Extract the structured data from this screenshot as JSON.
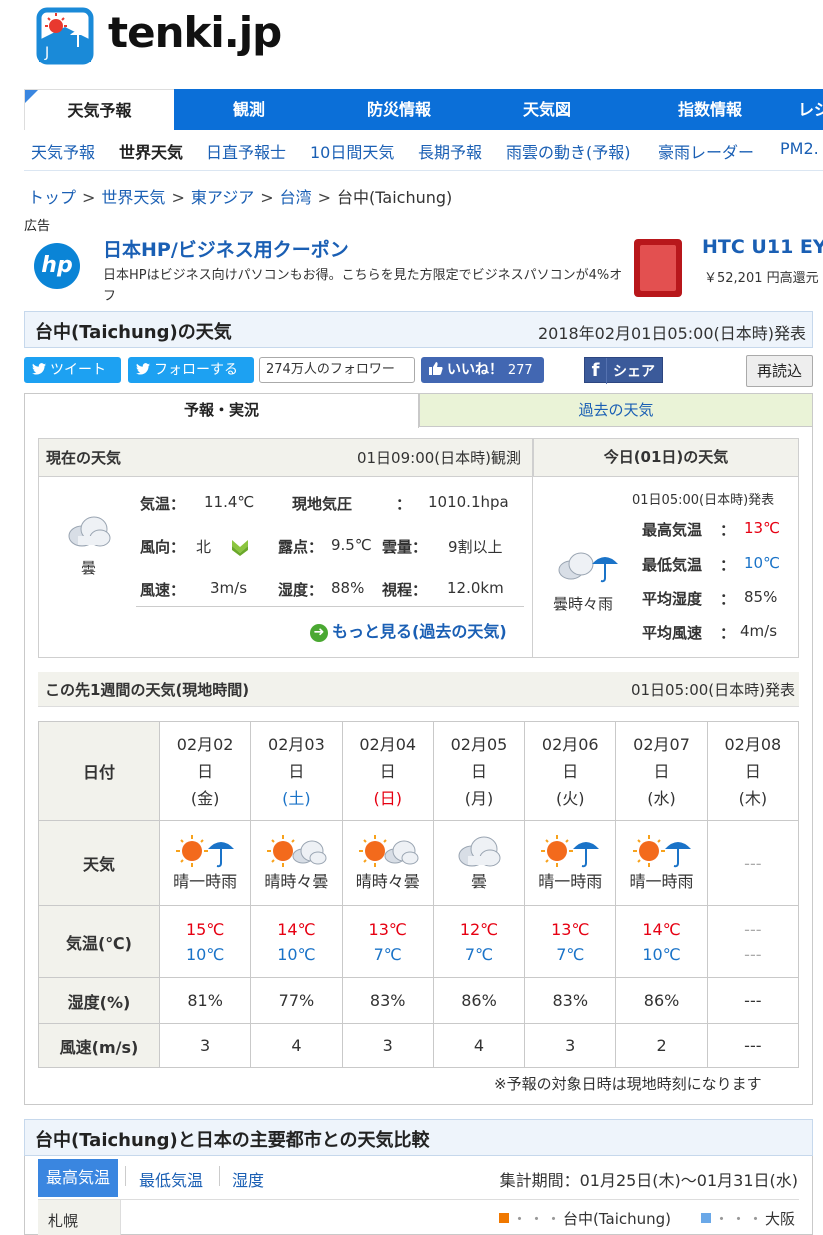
{
  "site": {
    "name": "tenki.jp"
  },
  "mainnav": [
    {
      "label": "天気予報",
      "active": true
    },
    {
      "label": "観測"
    },
    {
      "label": "防災情報"
    },
    {
      "label": "天気図"
    },
    {
      "label": "指数情報"
    },
    {
      "label": "レジ"
    }
  ],
  "subnav": [
    {
      "label": "天気予報"
    },
    {
      "label": "世界天気",
      "active": true
    },
    {
      "label": "日直予報士"
    },
    {
      "label": "10日間天気"
    },
    {
      "label": "長期予報"
    },
    {
      "label": "雨雲の動き(予報)"
    },
    {
      "label": "豪雨レーダー"
    },
    {
      "label": "PM2."
    }
  ],
  "breadcrumb": [
    "トップ",
    "世界天気",
    "東アジア",
    "台湾",
    "台中(Taichung)"
  ],
  "breadcrumb_sep": ">",
  "ads": {
    "label": "広告",
    "ad1": {
      "logo": "hp",
      "title": "日本HP/ビジネス用クーポン",
      "desc": "日本HPはビジネス向けパソコンもお得。こちらを見た方限定でビジネスパソコンが4%オフ"
    },
    "ad2": {
      "title": "HTC U11 EY",
      "desc": "￥52,201 円高還元"
    }
  },
  "page": {
    "title": "台中(Taichung)の天気",
    "issued": "2018年02月01日05:00(日本時)発表"
  },
  "social": {
    "tweet": "ツイート",
    "follow": "フォローする",
    "followers": "274万人のフォロワー",
    "like": "いいね！",
    "like_count": "277",
    "share_f": "f",
    "share": "シェア",
    "reload": "再読込"
  },
  "tabs": {
    "forecast": "予報・実況",
    "past": "過去の天気"
  },
  "current": {
    "heading": "現在の天気",
    "observed": "01日09:00(日本時)観測",
    "icon": "cloud-icon",
    "weather": "曇",
    "temp_label": "気温：",
    "temp": "11.4℃",
    "pressure_label": "現地気圧",
    "pressure_colon": "：",
    "pressure": "1010.1hpa",
    "wind_dir_label": "風向：",
    "wind_dir": "北",
    "dew_label": "露点：",
    "dew": "9.5℃",
    "cloud_label": "雲量：",
    "cloud": "9割以上",
    "wind_speed_label": "風速：",
    "wind_speed": "3m/s",
    "humidity_label": "湿度：",
    "humidity": "88%",
    "visibility_label": "視程：",
    "visibility": "12.0km",
    "more": "もっと見る(過去の天気)"
  },
  "today": {
    "heading": "今日(01日)の天気",
    "issued": "01日05:00(日本時)発表",
    "icon": "cloud-rain-icon",
    "weather": "曇時々雨",
    "max_label": "最高気温",
    "max": "13℃",
    "min_label": "最低気温",
    "min": "10℃",
    "hum_label": "平均湿度",
    "hum": "85%",
    "wind_label": "平均風速",
    "wind": "4m/s",
    "colon": "："
  },
  "week": {
    "heading": "この先1週間の天気(現地時間)",
    "issued": "01日05:00(日本時)発表",
    "row_labels": {
      "date": "日付",
      "weather": "天気",
      "temp": "気温(℃)",
      "humidity": "湿度(%)",
      "wind": "風速(m/s)"
    },
    "day_suffix": "日",
    "days": [
      {
        "date": "02月02",
        "dow": "(金)",
        "dow_color": "normal",
        "icon": "sun-umbrella-icon",
        "weather": "晴一時雨",
        "hi": "15℃",
        "lo": "10℃",
        "hum": "81%",
        "wind": "3"
      },
      {
        "date": "02月03",
        "dow": "(土)",
        "dow_color": "blue",
        "icon": "sun-cloud-icon",
        "weather": "晴時々曇",
        "hi": "14℃",
        "lo": "10℃",
        "hum": "77%",
        "wind": "4"
      },
      {
        "date": "02月04",
        "dow": "(日)",
        "dow_color": "red",
        "icon": "sun-cloud-icon",
        "weather": "晴時々曇",
        "hi": "13℃",
        "lo": "7℃",
        "hum": "83%",
        "wind": "3"
      },
      {
        "date": "02月05",
        "dow": "(月)",
        "dow_color": "normal",
        "icon": "cloud-icon",
        "weather": "曇",
        "hi": "12℃",
        "lo": "7℃",
        "hum": "86%",
        "wind": "4"
      },
      {
        "date": "02月06",
        "dow": "(火)",
        "dow_color": "normal",
        "icon": "sun-umbrella-icon",
        "weather": "晴一時雨",
        "hi": "13℃",
        "lo": "7℃",
        "hum": "83%",
        "wind": "3"
      },
      {
        "date": "02月07",
        "dow": "(水)",
        "dow_color": "normal",
        "icon": "sun-umbrella-icon",
        "weather": "晴一時雨",
        "hi": "14℃",
        "lo": "10℃",
        "hum": "86%",
        "wind": "2"
      },
      {
        "date": "02月08",
        "dow": "(木)",
        "dow_color": "normal",
        "icon": "",
        "weather": "---",
        "hi": "---",
        "lo": "---",
        "hum": "---",
        "wind": "---"
      }
    ],
    "note": "※予報の対象日時は現地時刻になります"
  },
  "compare": {
    "title": "台中(Taichung)と日本の主要都市との天気比較",
    "tabs": [
      "最高気温",
      "最低気温",
      "湿度"
    ],
    "period": "集計期間：01月25日(木)〜01月31日(水)",
    "city": "札幌",
    "legend": [
      {
        "name": "台中(Taichung)",
        "color": "#f07800"
      },
      {
        "name": "大阪",
        "color": "#6aa8e8"
      }
    ],
    "legend_dots": "・・・"
  },
  "colors": {
    "brand_blue": "#0b6fd8",
    "link": "#1a5fb4",
    "hi_temp": "#e60012",
    "lo_temp": "#1a73c8"
  }
}
